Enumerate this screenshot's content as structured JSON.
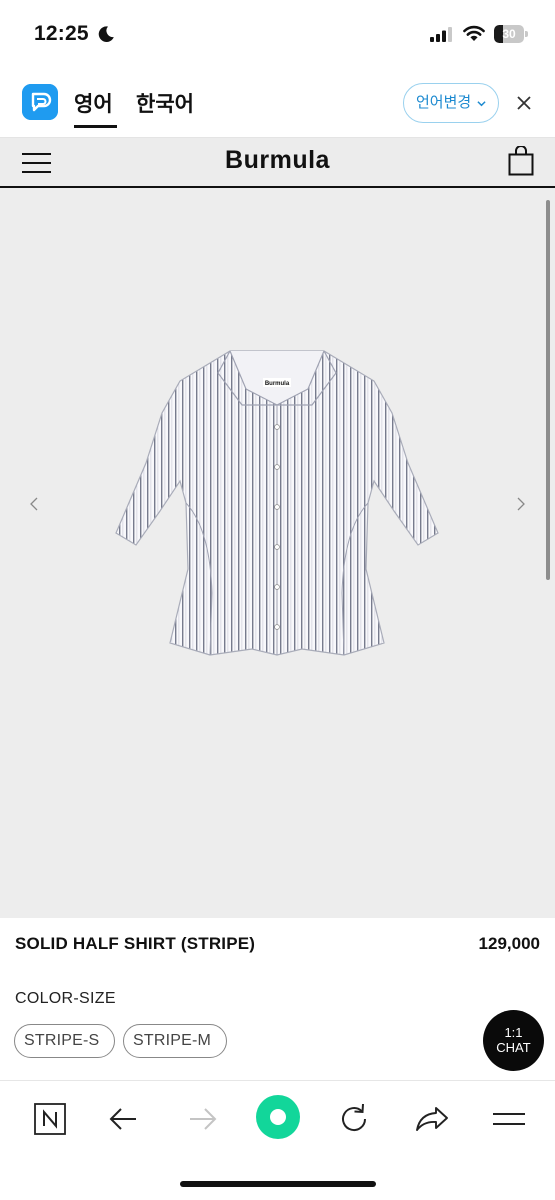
{
  "status_bar": {
    "time": "12:25",
    "battery_level": "30",
    "battery_fraction": 0.3
  },
  "translate_bar": {
    "tab_english": "영어",
    "tab_korean": "한국어",
    "language_change": "언어변경"
  },
  "site": {
    "brand": "Burmula"
  },
  "product": {
    "image_brand_tag": "Burmula",
    "name": "SOLID HALF SHIRT (STRIPE)",
    "price": "129,000",
    "option_label": "COLOR-SIZE",
    "options": [
      "STRIPE-S",
      "STRIPE-M"
    ]
  },
  "chat": {
    "line1": "1:1",
    "line2": "CHAT"
  },
  "colors": {
    "accent_green": "#12d69a",
    "translate_blue": "#1d8ad0",
    "gallery_bg": "#ededed"
  },
  "icons": {
    "status": [
      "moon-icon",
      "cellular-signal-icon",
      "wifi-icon",
      "battery-icon"
    ],
    "translate": [
      "papago-icon",
      "chevron-down-icon",
      "close-icon"
    ],
    "header": [
      "hamburger-menu-icon",
      "shopping-bag-icon"
    ],
    "gallery": [
      "chevron-left-icon",
      "chevron-right-icon"
    ],
    "browser": [
      "naver-n-icon",
      "back-arrow-icon",
      "forward-arrow-icon",
      "green-dot-icon",
      "reload-icon",
      "share-icon",
      "menu-icon"
    ]
  }
}
